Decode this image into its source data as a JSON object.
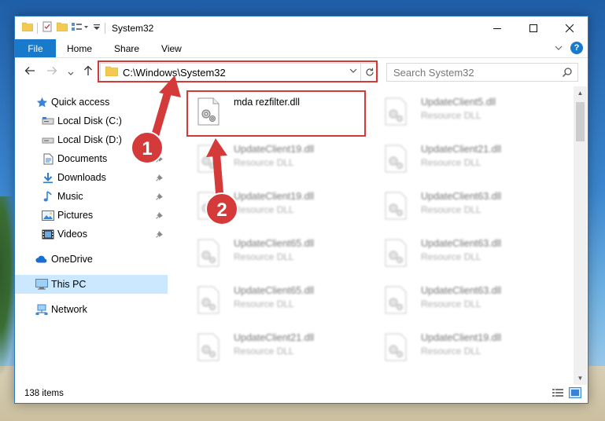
{
  "window": {
    "title": "System32",
    "controls": {
      "minimize": "minimize",
      "maximize": "maximize",
      "close": "close"
    }
  },
  "ribbon": {
    "file": "File",
    "tabs": [
      "Home",
      "Share",
      "View"
    ]
  },
  "address": {
    "path": "C:\\Windows\\System32"
  },
  "search": {
    "placeholder": "Search System32"
  },
  "sidebar": {
    "quick_access": "Quick access",
    "items": [
      {
        "label": "Local Disk (C:)",
        "icon": "drive-icon"
      },
      {
        "label": "Local Disk (D:)",
        "icon": "drive-icon"
      },
      {
        "label": "Documents",
        "icon": "documents-icon"
      },
      {
        "label": "Downloads",
        "icon": "downloads-icon"
      },
      {
        "label": "Music",
        "icon": "music-icon"
      },
      {
        "label": "Pictures",
        "icon": "pictures-icon"
      },
      {
        "label": "Videos",
        "icon": "videos-icon"
      }
    ],
    "onedrive": "OneDrive",
    "this_pc": "This PC",
    "network": "Network"
  },
  "files": {
    "highlighted": {
      "name": "mda rezfilter.dll",
      "type": ""
    },
    "col1": [
      {
        "name": "UpdateClient19.dll",
        "type": "Resource DLL"
      },
      {
        "name": "UpdateClient19.dll",
        "type": "Resource DLL"
      },
      {
        "name": "UpdateClient65.dll",
        "type": "Resource DLL"
      },
      {
        "name": "UpdateClient65.dll",
        "type": "Resource DLL"
      },
      {
        "name": "UpdateClient21.dll",
        "type": "Resource DLL"
      }
    ],
    "col2": [
      {
        "name": "UpdateClient5.dll",
        "type": "Resource DLL"
      },
      {
        "name": "UpdateClient21.dll",
        "type": "Resource DLL"
      },
      {
        "name": "UpdateClient63.dll",
        "type": "Resource DLL"
      },
      {
        "name": "UpdateClient63.dll",
        "type": "Resource DLL"
      },
      {
        "name": "UpdateClient63.dll",
        "type": "Resource DLL"
      },
      {
        "name": "UpdateClient19.dll",
        "type": "Resource DLL"
      }
    ]
  },
  "status": {
    "item_count": "138 items"
  },
  "annotations": {
    "step1": "1",
    "step2": "2",
    "color": "#d53a3a"
  },
  "colors": {
    "accent": "#1979ca",
    "selection": "#cce8ff",
    "highlight": "#d53a3a"
  }
}
